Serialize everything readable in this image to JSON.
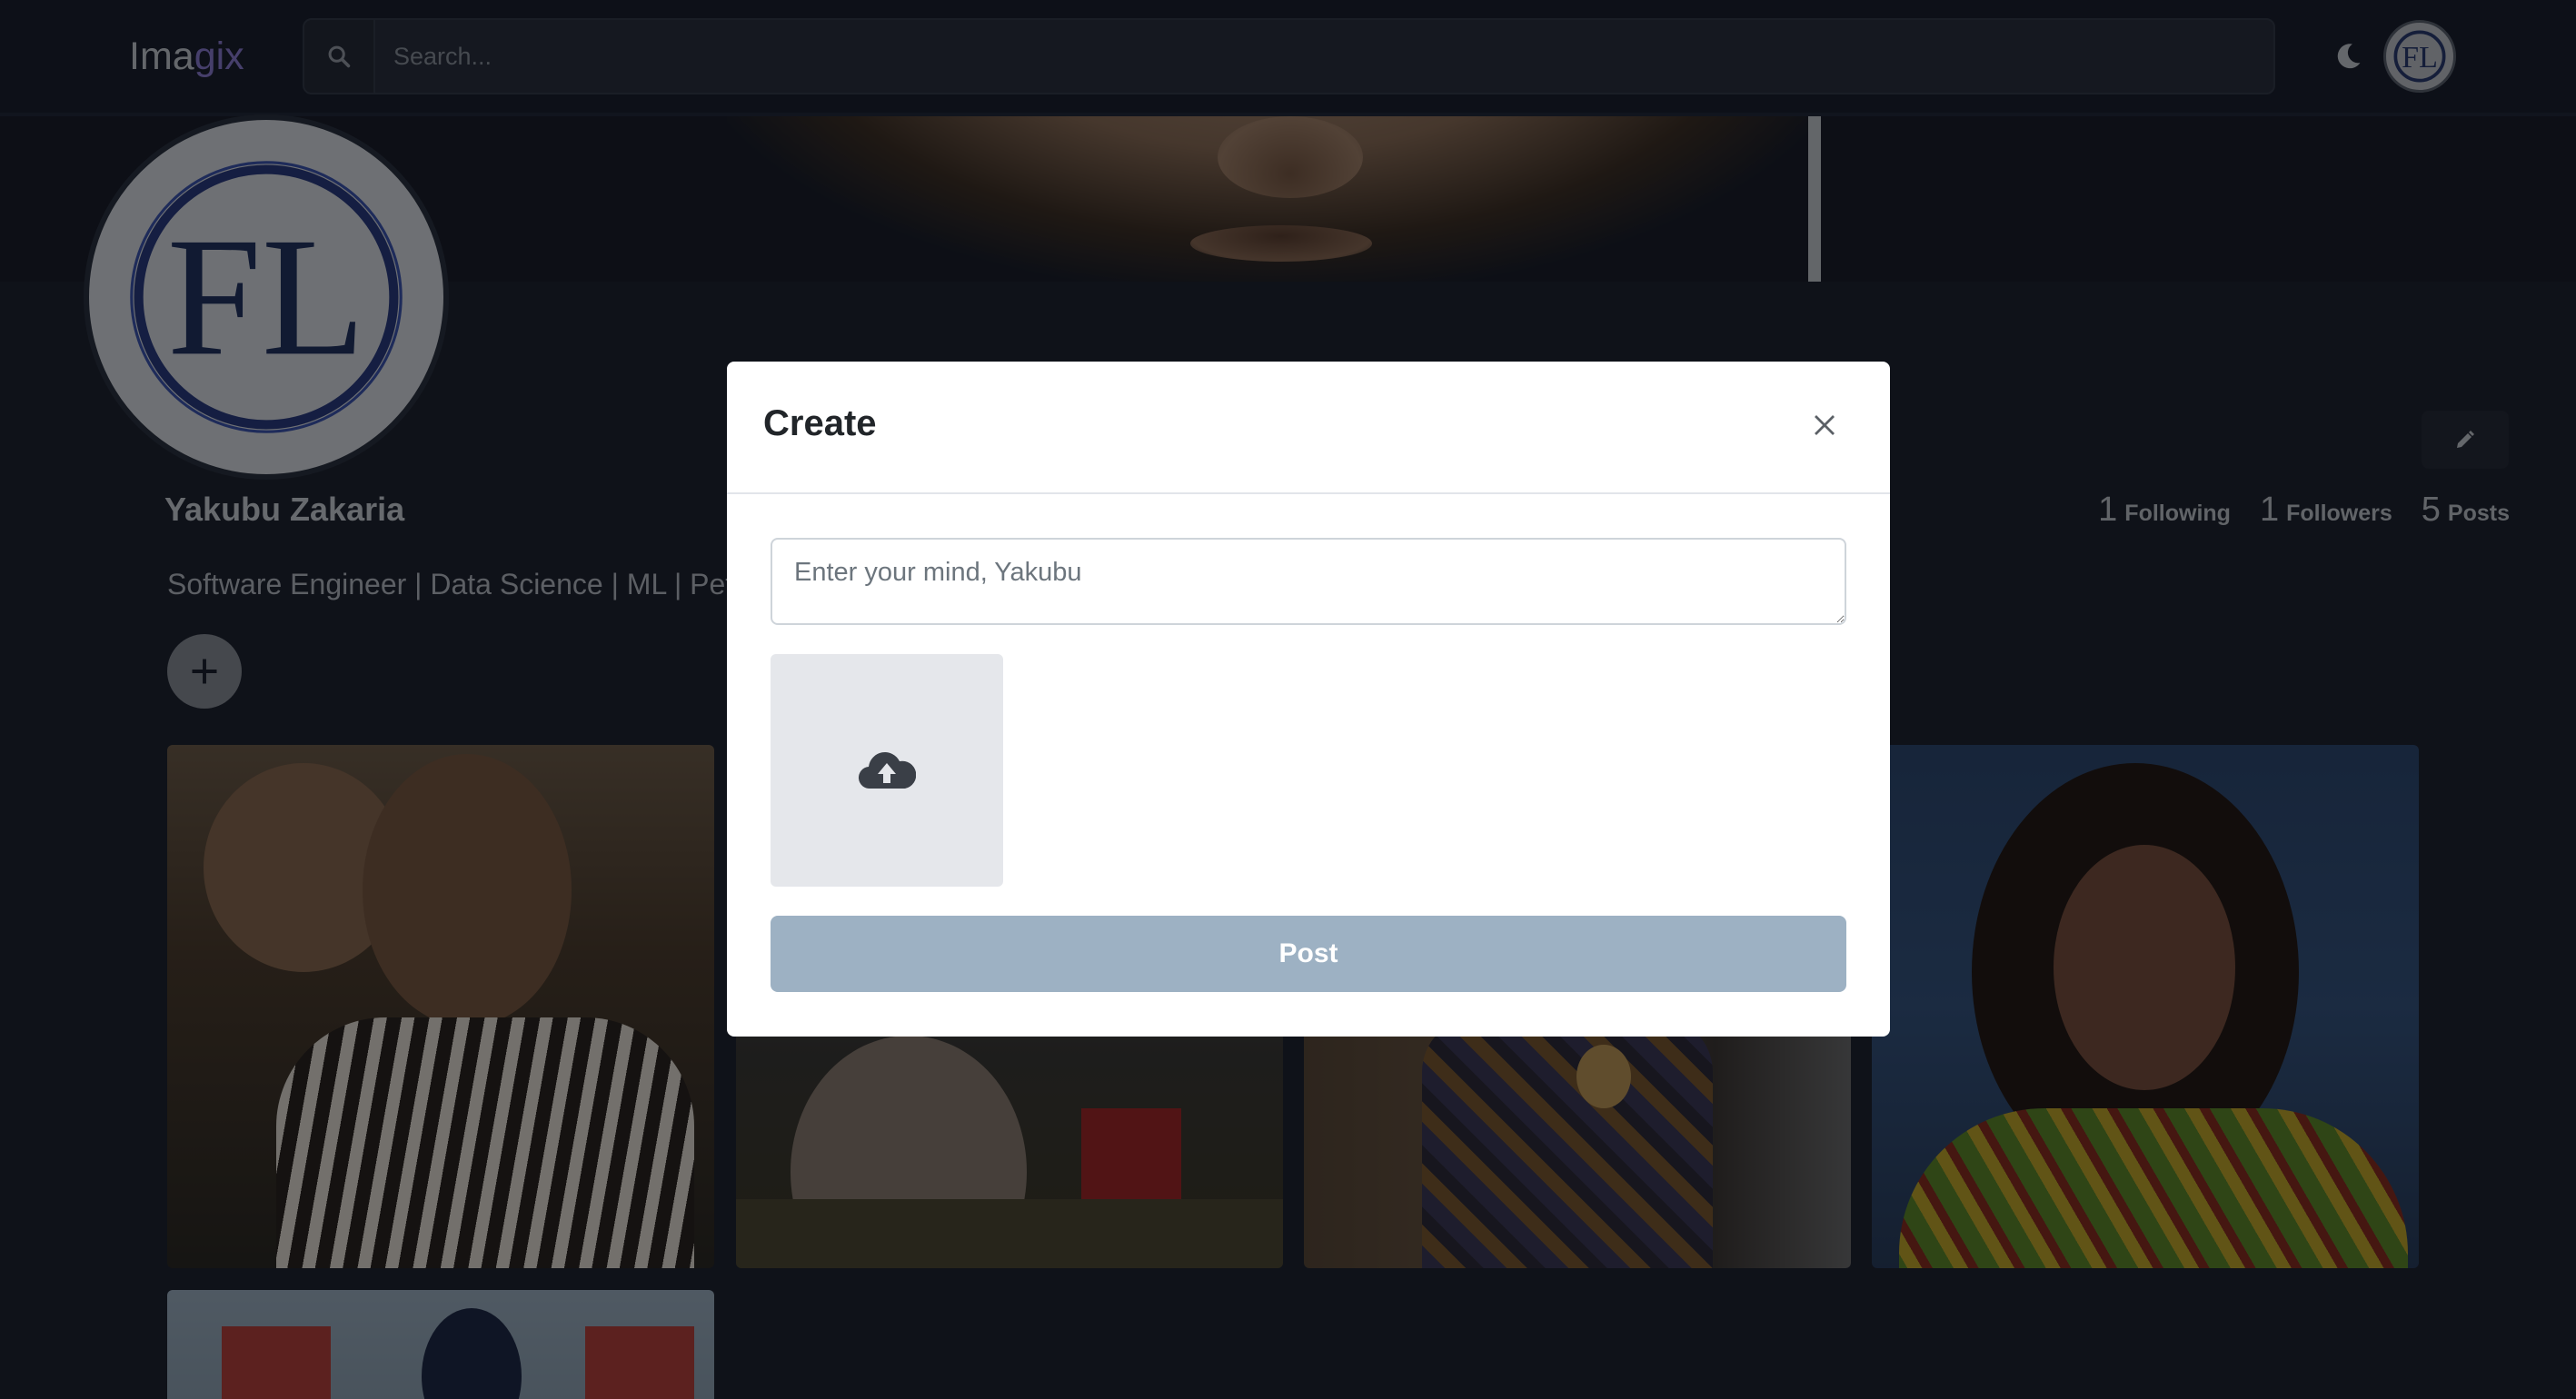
{
  "app": {
    "logo_prefix": "Ima",
    "logo_accent": "gix",
    "accent_color": "#8c7fd6"
  },
  "navbar": {
    "search": {
      "placeholder": "Search...",
      "icon": "search-icon"
    },
    "theme_toggle_icon": "moon-icon",
    "avatar_initials": "FL"
  },
  "profile": {
    "name": "Yakubu Zakaria",
    "bio": "Software Engineer | Data Science | ML | Petr",
    "avatar_initials": "FL",
    "add_icon": "plus-icon",
    "edit_icon": "pencil-icon",
    "stats": [
      {
        "count": "1",
        "label": "Following"
      },
      {
        "count": "1",
        "label": "Followers"
      },
      {
        "count": "5",
        "label": "Posts"
      }
    ]
  },
  "modal": {
    "title": "Create",
    "close_icon": "close-icon",
    "textarea_placeholder": "Enter your mind, Yakubu",
    "upload_icon": "cloud-upload-icon",
    "post_label": "Post",
    "post_button_color": "#9db1c3"
  }
}
